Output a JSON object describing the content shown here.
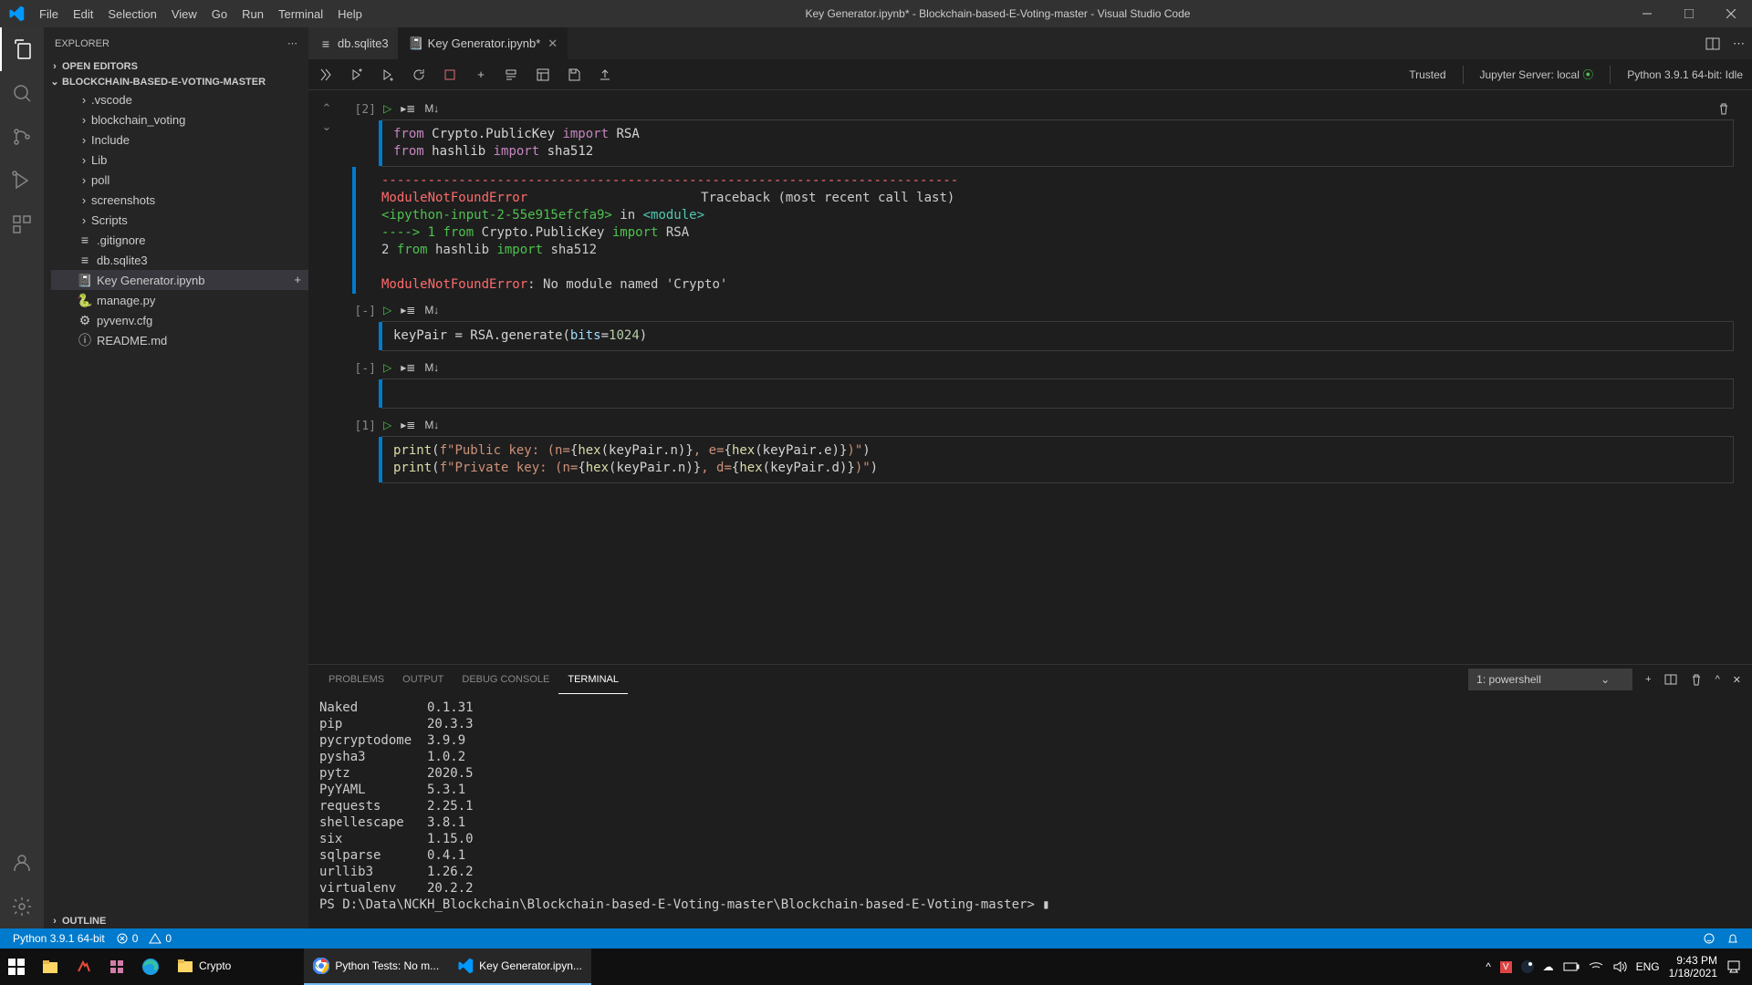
{
  "title": "Key Generator.ipynb* - Blockchain-based-E-Voting-master - Visual Studio Code",
  "menu": [
    "File",
    "Edit",
    "Selection",
    "View",
    "Go",
    "Run",
    "Terminal",
    "Help"
  ],
  "explorer": {
    "title": "EXPLORER",
    "sections": {
      "open_editors": "OPEN EDITORS",
      "project": "BLOCKCHAIN-BASED-E-VOTING-MASTER",
      "outline": "OUTLINE"
    },
    "tree": [
      {
        "type": "folder",
        "label": ".vscode"
      },
      {
        "type": "folder",
        "label": "blockchain_voting"
      },
      {
        "type": "folder",
        "label": "Include"
      },
      {
        "type": "folder",
        "label": "Lib"
      },
      {
        "type": "folder",
        "label": "poll"
      },
      {
        "type": "folder",
        "label": "screenshots"
      },
      {
        "type": "folder",
        "label": "Scripts"
      },
      {
        "type": "file",
        "label": ".gitignore",
        "icon": "≡"
      },
      {
        "type": "file",
        "label": "db.sqlite3",
        "icon": "≡"
      },
      {
        "type": "file",
        "label": "Key Generator.ipynb",
        "icon": "📓",
        "selected": true
      },
      {
        "type": "file",
        "label": "manage.py",
        "icon": "🐍"
      },
      {
        "type": "file",
        "label": "pyvenv.cfg",
        "icon": "⚙"
      },
      {
        "type": "file",
        "label": "README.md",
        "icon": "ⓘ"
      }
    ]
  },
  "tabs": [
    {
      "label": "db.sqlite3",
      "icon": "≡",
      "active": false,
      "dirty": false
    },
    {
      "label": "Key Generator.ipynb",
      "icon": "📓",
      "active": true,
      "dirty": true
    }
  ],
  "notebook": {
    "trusted": "Trusted",
    "server": "Jupyter Server: local",
    "kernel": "Python 3.9.1 64-bit: Idle",
    "cells": [
      {
        "exec": "[2]",
        "code_lines": [
          {
            "segments": [
              {
                "t": "from ",
                "c": "kw"
              },
              {
                "t": "Crypto.PublicKey ",
                "c": "punct"
              },
              {
                "t": "import ",
                "c": "kw"
              },
              {
                "t": "RSA",
                "c": "punct"
              }
            ]
          },
          {
            "segments": [
              {
                "t": "from ",
                "c": "kw"
              },
              {
                "t": "hashlib ",
                "c": "punct"
              },
              {
                "t": "import ",
                "c": "kw"
              },
              {
                "t": "sha512",
                "c": "punct"
              }
            ]
          }
        ],
        "has_fold": true,
        "output_text": true
      },
      {
        "exec": "[-]",
        "code_lines": [
          {
            "segments": [
              {
                "t": "keyPair ",
                "c": "punct"
              },
              {
                "t": "= ",
                "c": "punct"
              },
              {
                "t": "RSA.generate(",
                "c": "punct"
              },
              {
                "t": "bits",
                "c": "param"
              },
              {
                "t": "=",
                "c": "punct"
              },
              {
                "t": "1024",
                "c": "num"
              },
              {
                "t": ")",
                "c": "punct"
              }
            ]
          }
        ]
      },
      {
        "exec": "[-]",
        "code_lines": [
          {
            "segments": []
          }
        ]
      },
      {
        "exec": "[1]",
        "code_lines": [
          {
            "segments": [
              {
                "t": "print",
                "c": "fn"
              },
              {
                "t": "(",
                "c": "punct"
              },
              {
                "t": "f\"",
                "c": "str"
              },
              {
                "t": "Public key:  (n=",
                "c": "str"
              },
              {
                "t": "{",
                "c": "punct"
              },
              {
                "t": "hex",
                "c": "fn"
              },
              {
                "t": "(keyPair.n)",
                "c": "punct"
              },
              {
                "t": "}",
                "c": "punct"
              },
              {
                "t": ", e=",
                "c": "str"
              },
              {
                "t": "{",
                "c": "punct"
              },
              {
                "t": "hex",
                "c": "fn"
              },
              {
                "t": "(keyPair.e)",
                "c": "punct"
              },
              {
                "t": "}",
                "c": "punct"
              },
              {
                "t": ")\"",
                "c": "str"
              },
              {
                "t": ")",
                "c": "punct"
              }
            ]
          },
          {
            "segments": [
              {
                "t": "print",
                "c": "fn"
              },
              {
                "t": "(",
                "c": "punct"
              },
              {
                "t": "f\"",
                "c": "str"
              },
              {
                "t": "Private key: (n=",
                "c": "str"
              },
              {
                "t": "{",
                "c": "punct"
              },
              {
                "t": "hex",
                "c": "fn"
              },
              {
                "t": "(keyPair.n)",
                "c": "punct"
              },
              {
                "t": "}",
                "c": "punct"
              },
              {
                "t": ", d=",
                "c": "str"
              },
              {
                "t": "{",
                "c": "punct"
              },
              {
                "t": "hex",
                "c": "fn"
              },
              {
                "t": "(keyPair.d)",
                "c": "punct"
              },
              {
                "t": "}",
                "c": "punct"
              },
              {
                "t": ")\"",
                "c": "str"
              },
              {
                "t": ")",
                "c": "punct"
              }
            ]
          }
        ]
      }
    ],
    "error": {
      "dashes": "---------------------------------------------------------------------------",
      "name": "ModuleNotFoundError",
      "traceback": "Traceback (most recent call last)",
      "frame": "<ipython-input-2-55e915efcfa9>",
      "in_text": " in ",
      "module_link": "<module>",
      "line1_arrow": "----> 1 ",
      "line1_from": "from",
      "line1_mod": " Crypto.PublicKey ",
      "line1_import": "import",
      "line1_name": " RSA",
      "line2_num": "      2 ",
      "line2_from": "from",
      "line2_mod": " hashlib ",
      "line2_import": "import",
      "line2_name": " sha512",
      "final_name": "ModuleNotFoundError",
      "final_msg": ": No module named 'Crypto'"
    }
  },
  "panel": {
    "tabs": [
      "PROBLEMS",
      "OUTPUT",
      "DEBUG CONSOLE",
      "TERMINAL"
    ],
    "active": 3,
    "term_select": "1: powershell",
    "terminal_lines": [
      "Naked         0.1.31",
      "pip           20.3.3",
      "pycryptodome  3.9.9",
      "pysha3        1.0.2",
      "pytz          2020.5",
      "PyYAML        5.3.1",
      "requests      2.25.1",
      "shellescape   3.8.1",
      "six           1.15.0",
      "sqlparse      0.4.1",
      "urllib3       1.26.2",
      "virtualenv    20.2.2",
      "PS D:\\Data\\NCKH_Blockchain\\Blockchain-based-E-Voting-master\\Blockchain-based-E-Voting-master> ▮"
    ]
  },
  "statusbar": {
    "python": "Python 3.9.1 64-bit",
    "errors": "0",
    "warnings": "0"
  },
  "taskbar": {
    "crypto_label": "Crypto",
    "chrome_label": "Python Tests: No m...",
    "vscode_label": "Key Generator.ipyn...",
    "lang": "ENG",
    "time": "9:43 PM",
    "date": "1/18/2021"
  }
}
